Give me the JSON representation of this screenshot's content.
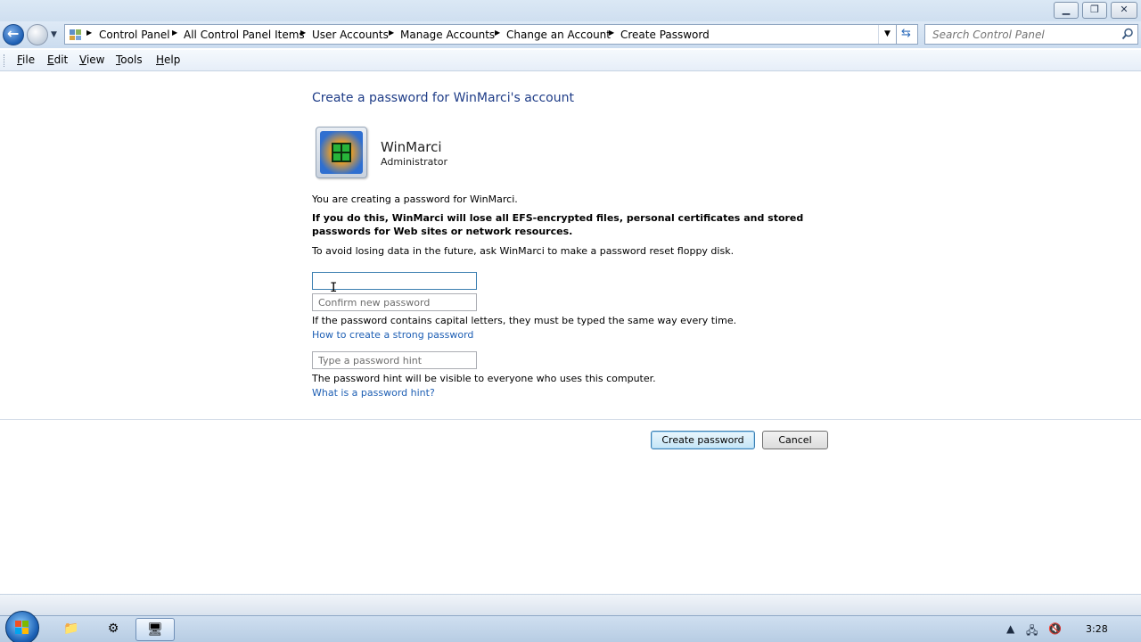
{
  "window": {
    "controls": {
      "minimize": "▁",
      "maximize": "❐",
      "close": "✕"
    }
  },
  "address_bar": {
    "crumbs": [
      "Control Panel",
      "All Control Panel Items",
      "User Accounts",
      "Manage Accounts",
      "Change an Account",
      "Create Password"
    ],
    "icon": "control-panel-icon"
  },
  "search": {
    "placeholder": "Search Control Panel"
  },
  "menu": {
    "items": [
      "File",
      "Edit",
      "View",
      "Tools",
      "Help"
    ],
    "underlined": [
      "F",
      "E",
      "V",
      "T",
      "H"
    ]
  },
  "content": {
    "heading": "Create a password for WinMarci's account",
    "user": {
      "name": "WinMarci",
      "role": "Administrator"
    },
    "intro": "You are creating a password for WinMarci.",
    "warning": "If you do this, WinMarci will lose all EFS-encrypted files, personal certificates and stored passwords for Web sites or network resources.",
    "advice": "To avoid losing data in the future, ask WinMarci to make a password reset floppy disk.",
    "new_password": {
      "value": "",
      "placeholder": ""
    },
    "confirm_password": {
      "placeholder": "Confirm new password"
    },
    "capitals_note": "If the password contains capital letters, they must be typed the same way every time.",
    "strong_link": "How to create a strong password",
    "hint": {
      "placeholder": "Type a password hint"
    },
    "hint_note": "The password hint will be visible to everyone who uses this computer.",
    "hint_link": "What is a password hint?",
    "create_button": "Create password",
    "cancel_button": "Cancel"
  },
  "taskbar": {
    "items": [
      "explorer-icon",
      "maintenance-icon",
      "control-panel-icon"
    ],
    "clock": "3:28",
    "tray": [
      "show-hidden-icons-arrow",
      "network-icon",
      "volume-muted-icon"
    ]
  },
  "colors": {
    "heading": "#1e3c87",
    "link": "#1e5fb4",
    "accent": "#3c7fb1"
  }
}
